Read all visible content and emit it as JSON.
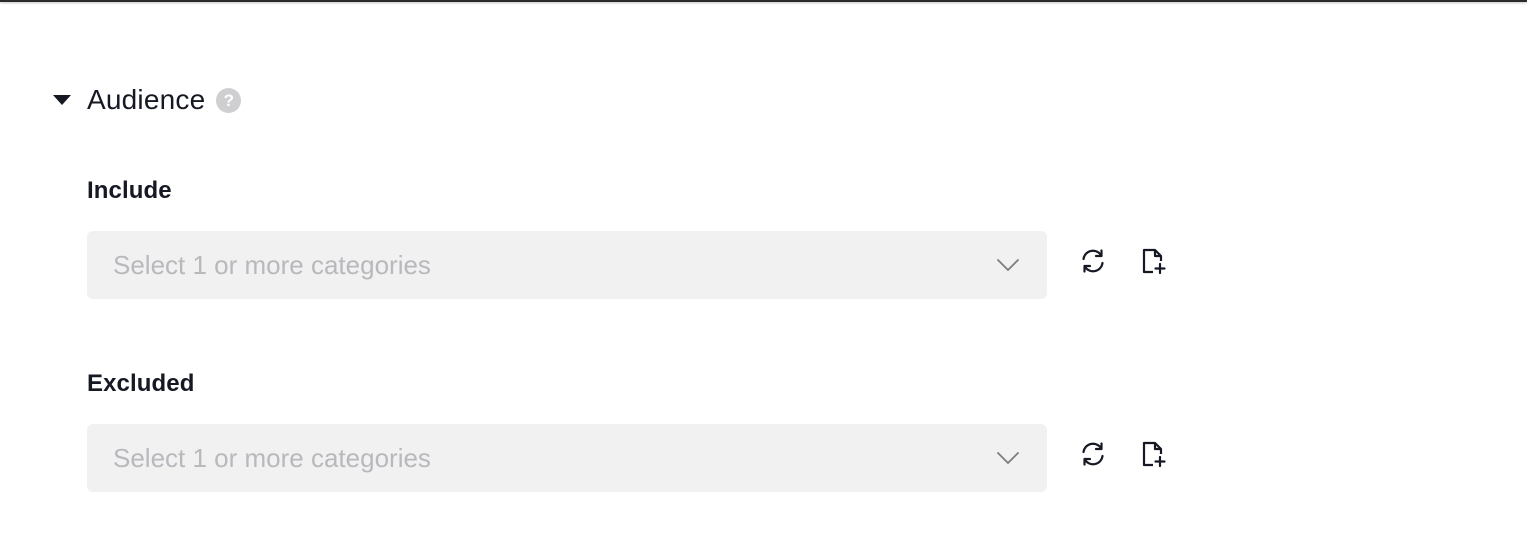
{
  "section": {
    "title": "Audience",
    "help_icon": "question-circle-icon",
    "caret_icon": "caret-down-icon"
  },
  "include": {
    "label": "Include",
    "placeholder": "Select 1 or more categories",
    "refresh_icon": "refresh-icon",
    "add_file_icon": "file-add-icon"
  },
  "excluded": {
    "label": "Excluded",
    "placeholder": "Select 1 or more categories",
    "refresh_icon": "refresh-icon",
    "add_file_icon": "file-add-icon"
  },
  "colors": {
    "text": "#161823",
    "field_bg": "#f1f1f2",
    "placeholder": "#b9b9bd",
    "help_icon_bg": "#cfcfd1"
  }
}
